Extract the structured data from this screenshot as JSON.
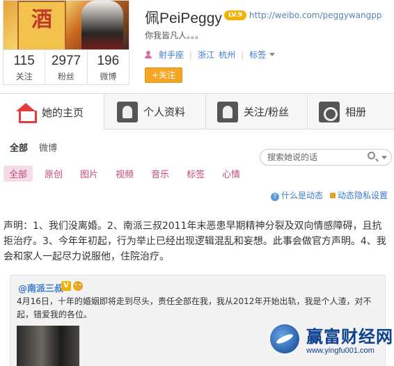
{
  "profile": {
    "name": "佩PeiPeggy",
    "level": "LV.9",
    "url": "http://weibo.com/peggywangpp",
    "bio": "你我皆凡人。。。",
    "zodiac": "射手座",
    "province": "浙江",
    "city": "杭州",
    "tags_label": "标签",
    "follow_label": "+关注",
    "avatar_text": "酒"
  },
  "stats": [
    {
      "num": "115",
      "label": "关注"
    },
    {
      "num": "2977",
      "label": "粉丝"
    },
    {
      "num": "196",
      "label": "微博"
    }
  ],
  "tabs": [
    {
      "label": "她的主页"
    },
    {
      "label": "个人资料"
    },
    {
      "label": "关注/粉丝"
    },
    {
      "label": "相册"
    }
  ],
  "subtabs": [
    "全部",
    "微博"
  ],
  "search": {
    "placeholder": "搜索她说的话"
  },
  "filters": [
    "全部",
    "原创",
    "图片",
    "视频",
    "音乐",
    "标签",
    "心情"
  ],
  "help": {
    "what_is": "什么是动态",
    "privacy": "动态隐私设置"
  },
  "post": {
    "text": "声明：1、我们没离婚。2、南派三叔2011年末恶患早期精神分裂及双向情感障碍，且抗拒治疗。3、今年年初起，行为举止已经出现逻辑混乱和妄想。此事会做官方声明。4、我会和家人一起尽力说服他，住院治疗。"
  },
  "repost": {
    "author": "@南派三叔",
    "badge": "V",
    "text": "4月16日，十年的婚姻即将走到尽头，责任全部在我，我从2012年开始出轨，我是个人渣，对不起，错爱我的各位。"
  },
  "watermark": {
    "title": "赢富财经网",
    "url": "www.yingfu001.com"
  }
}
